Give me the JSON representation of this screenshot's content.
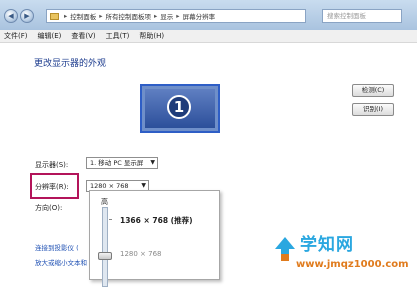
{
  "address_bar": {
    "crumbs": [
      "控制面板",
      "所有控制面板项",
      "显示",
      "屏幕分辨率"
    ],
    "back_icon": "back-arrow-icon",
    "forward_icon": "forward-arrow-icon"
  },
  "search": {
    "placeholder": "搜索控制面板"
  },
  "menu": {
    "file": "文件(F)",
    "edit": "编辑(E)",
    "view": "查看(V)",
    "tools": "工具(T)",
    "help": "帮助(H)"
  },
  "main": {
    "heading": "更改显示器的外观",
    "monitor_number": "1",
    "detect_button": "检测(C)",
    "identify_button": "识别(I)",
    "display_label": "显示器(S):",
    "display_value": "1. 移动 PC 显示屏",
    "resolution_label": "分辨率(R):",
    "resolution_value": "1280 × 768",
    "orientation_label": "方向(O):"
  },
  "resolution_dropdown": {
    "high_label": "高",
    "recommended": "1366 × 768 (推荐)",
    "current": "1280 × 768",
    "slider_level": 0.62
  },
  "links": {
    "projector": "连接到投影仪 (",
    "text_size": "放大或缩小文本和"
  },
  "watermark": {
    "title": "学知网",
    "url": "www.jmqz1000.com"
  },
  "colors": {
    "highlight_border": "#b3145a",
    "monitor_selected": "#2e5ec6",
    "link": "#1d4fb3"
  }
}
